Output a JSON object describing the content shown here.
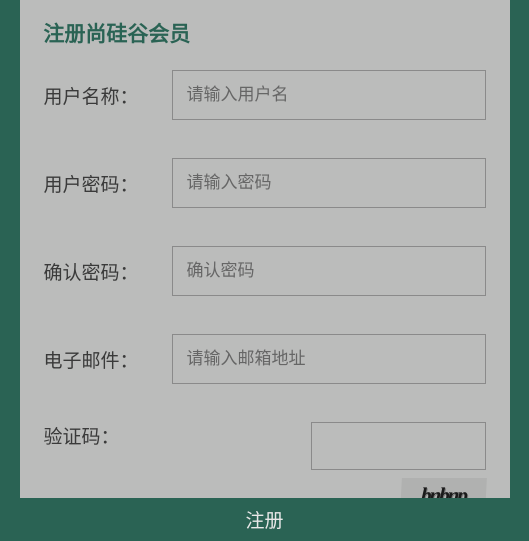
{
  "form": {
    "title": "注册尚硅谷会员",
    "username": {
      "label": "用户名称：",
      "placeholder": "请输入用户名"
    },
    "password": {
      "label": "用户密码：",
      "placeholder": "请输入密码"
    },
    "confirm": {
      "label": "确认密码：",
      "placeholder": "确认密码"
    },
    "email": {
      "label": "电子邮件：",
      "placeholder": "请输入邮箱地址"
    },
    "captcha": {
      "label": "验证码：",
      "text": "bnbnp"
    },
    "submit": "注册"
  }
}
